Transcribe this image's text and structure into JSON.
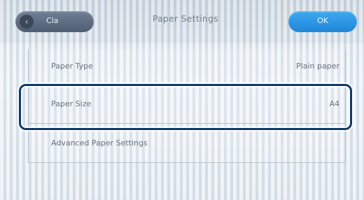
{
  "header": {
    "back_label": "Cla",
    "title": "Paper Settings",
    "ok_label": "OK"
  },
  "settings": [
    {
      "name": "Paper Type",
      "value": "Plain paper"
    },
    {
      "name": "Paper Size",
      "value": "A4"
    },
    {
      "name": "Advanced Paper Settings",
      "value": ""
    }
  ],
  "colors": {
    "highlight_border": "#123a66",
    "ok_button": "#2a96e3",
    "back_button": "#5d6b80"
  }
}
